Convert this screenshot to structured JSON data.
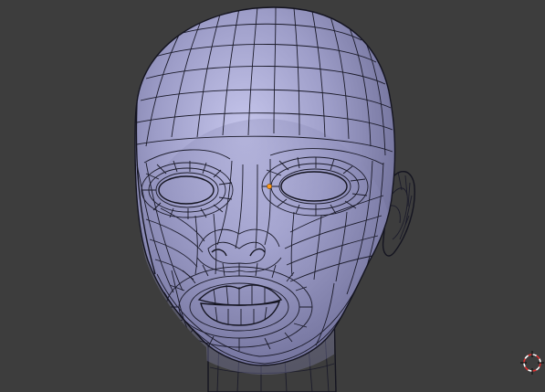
{
  "viewport": {
    "background": "#3d3d3d",
    "mesh_color": "#8f8fb8",
    "mesh_highlight": "#c3c3e8",
    "mesh_shadow": "#5a5a80",
    "wire_color": "#1b1b2a",
    "eye_color": "#d4d4d8",
    "selected_vertex_color": "#ff9a1a",
    "object": "head-mesh",
    "mode": "edit",
    "shading": "solid",
    "icons": {
      "cursor": "3d-cursor-icon",
      "vertex": "selected-vertex-icon"
    }
  }
}
